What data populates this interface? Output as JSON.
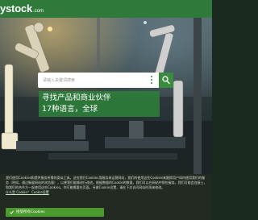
{
  "header": {
    "logo_main": "ystock",
    "logo_suffix": ".com"
  },
  "search": {
    "placeholder": "请输入关键词搜索"
  },
  "hero": {
    "tagline_line1": "寻找产品和商业伙伴",
    "tagline_line2": "17种语言，全球"
  },
  "cookie_banner": {
    "text": "我们使用Cookies和提供服务所需的类似工具。这些我们Cookies用服务来运营网站，我们的使用这些Cookies来跟踪用户如何使用我们的服务（例如，通过衡量网站的浏览量），以便我们能够进行改进。根据数据的Cookie的数量，我们可以在网站中那些服务。我们可能会连接上，和我们的合作方一起使用这些Cookies。你可能需要在页面，另做Cookie设置，请在下次访问网站时再来修改。",
    "links": "什么是 Cookie？ Cookie设置",
    "accept_label": "接受所有Cookies"
  },
  "colors": {
    "brand_green": "#2f7a3a",
    "accent_green": "#3a8a3f",
    "accept_green": "#4a9a2e",
    "banner_bg": "#222a22"
  }
}
